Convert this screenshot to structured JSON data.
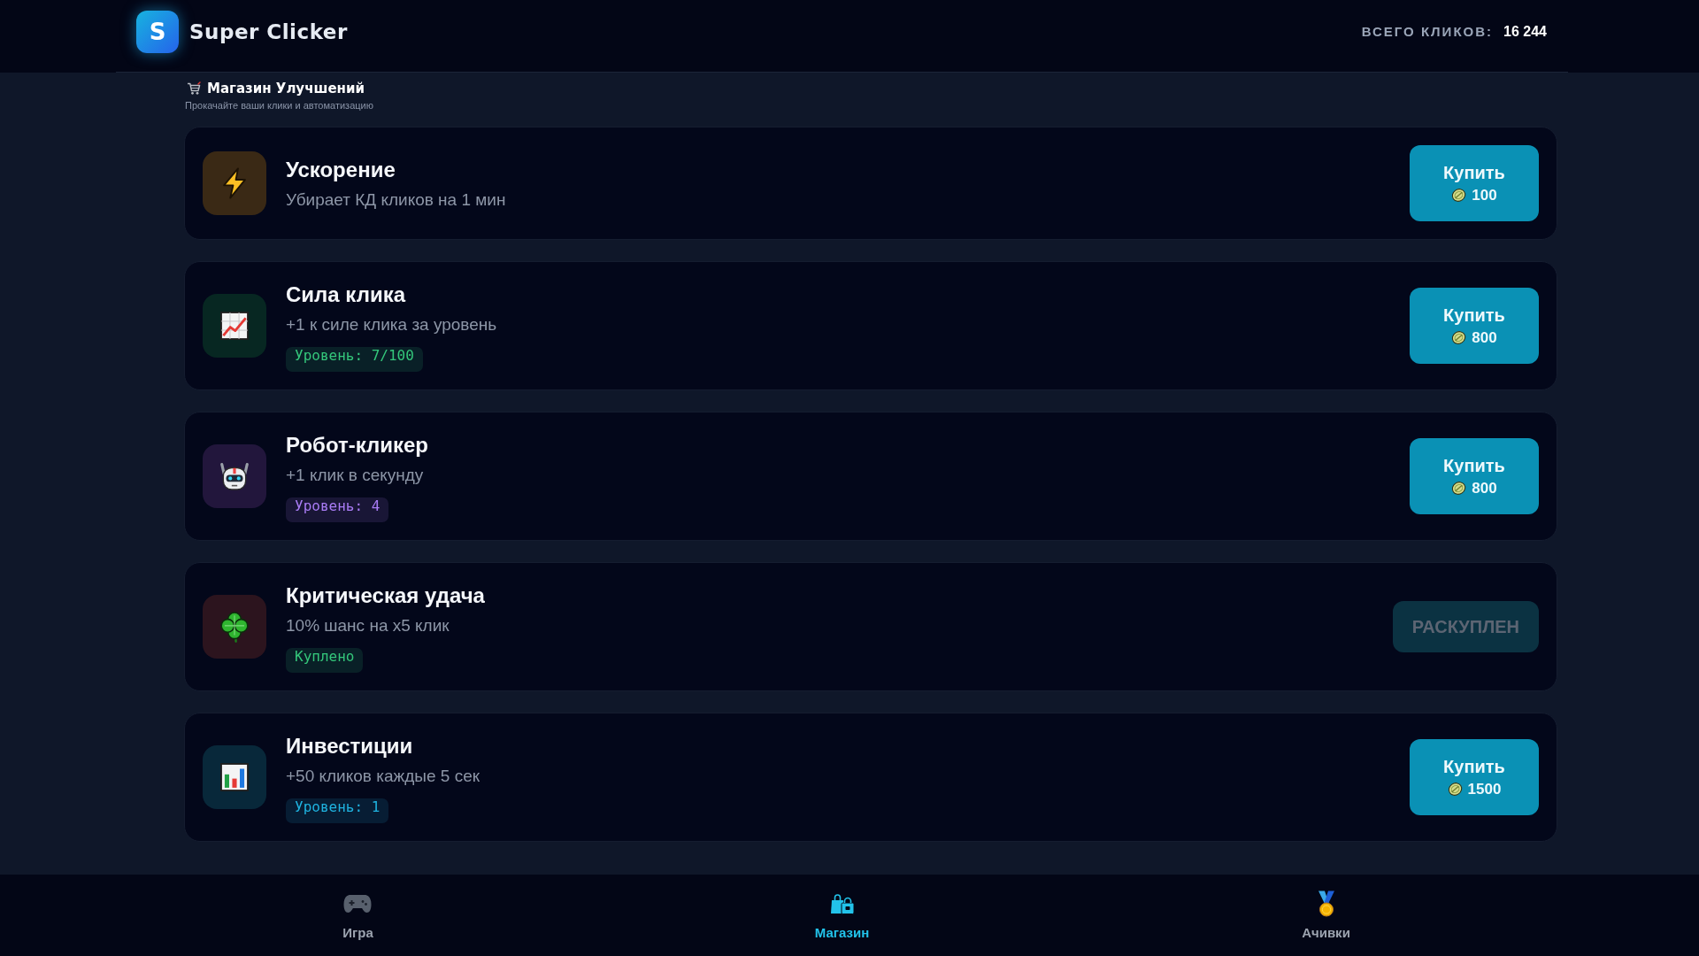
{
  "header": {
    "logo_letter": "S",
    "title": "Super Clicker",
    "counter_label": "ВСЕГО КЛИКОВ:",
    "counter_value": "16 244"
  },
  "shop": {
    "title": "Магазин Улучшений",
    "subtitle": "Прокачайте ваши клики и автоматизацию",
    "upgrades": [
      {
        "title": "Ускорение",
        "description": "Убирает КД кликов на 1 мин",
        "color": "#3a2915",
        "button": {
          "label": "Купить",
          "price": "100",
          "disabled": false
        }
      },
      {
        "title": "Сила клика",
        "description": "+1 к силе клика за уровень",
        "color": "#072722",
        "badge": {
          "text": "Уровень: 7/100",
          "color": "#34c77b"
        },
        "button": {
          "label": "Купить",
          "price": "800",
          "disabled": false
        }
      },
      {
        "title": "Робот-кликер",
        "description": "+1 клик в секунду",
        "color": "#22163c",
        "badge": {
          "text": "Уровень: 4",
          "color": "#a97cf5"
        },
        "button": {
          "label": "Купить",
          "price": "800",
          "disabled": false
        }
      },
      {
        "title": "Критическая удача",
        "description": "10% шанс на x5 клик",
        "color": "#2c141e",
        "badge": {
          "text": "Куплено",
          "color": "#34c77b"
        },
        "button": {
          "label": "РАСКУПЛЕН",
          "disabled": true
        }
      },
      {
        "title": "Инвестиции",
        "description": "+50 кликов каждые 5 сек",
        "color": "#08283a",
        "badge": {
          "text": "Уровень: 1",
          "color": "#1fb3e0"
        },
        "button": {
          "label": "Купить",
          "price": "1500",
          "disabled": false
        }
      }
    ]
  },
  "nav": [
    {
      "label": "Игра",
      "selected": false
    },
    {
      "label": "Магазин",
      "selected": true
    },
    {
      "label": "Ачивки",
      "selected": false
    }
  ]
}
